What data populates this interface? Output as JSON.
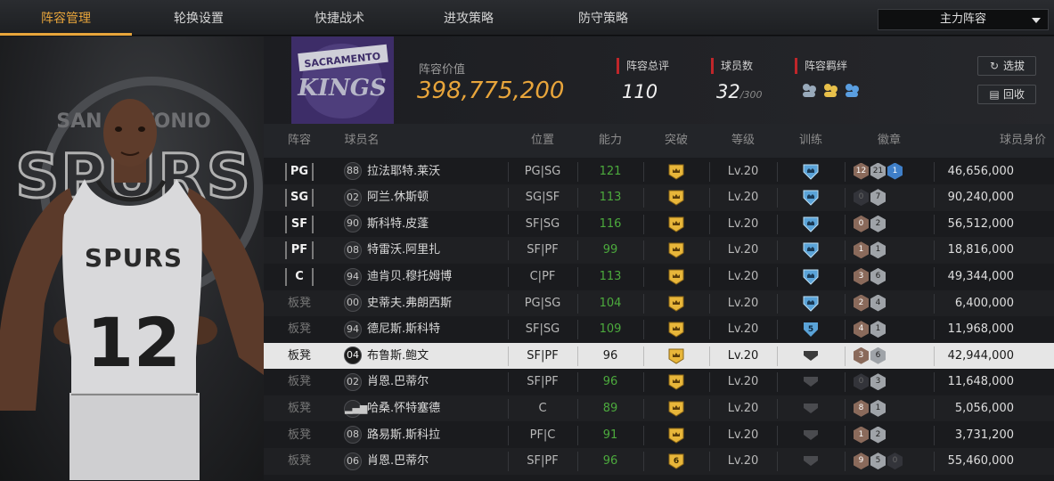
{
  "tabs": [
    {
      "label": "阵容管理",
      "active": true
    },
    {
      "label": "轮换设置",
      "active": false
    },
    {
      "label": "快捷战术",
      "active": false
    },
    {
      "label": "进攻策略",
      "active": false
    },
    {
      "label": "防守策略",
      "active": false
    }
  ],
  "lineup_select": {
    "value": "主力阵容"
  },
  "header": {
    "team_logo_text_top": "SACRAMENTO",
    "team_logo_text_main": "KINGS",
    "value_label": "阵容价值",
    "value": "398,775,200",
    "rating_label": "阵容总评",
    "rating": "110",
    "players_label": "球员数",
    "players_count": "32",
    "players_max": "/300",
    "bond_label": "阵容羁绊",
    "select_button": "选拔",
    "recycle_button": "回收"
  },
  "jersey": {
    "team": "SPURS",
    "number": "12",
    "bg_team": "SPURS",
    "bg_text": "SAN ANTONIO"
  },
  "columns": [
    "阵容",
    "球员名",
    "位置",
    "能力",
    "突破",
    "等级",
    "训练",
    "徽章",
    "球员身价"
  ],
  "rows": [
    {
      "slot": "PG",
      "starter": true,
      "number": "88",
      "name": "拉法耶特.莱沃",
      "pos": "PG|SG",
      "ability": "121",
      "level": "Lv.20",
      "train": "",
      "badges": [
        {
          "t": "12",
          "c": "bronze"
        },
        {
          "t": "21",
          "c": "silver"
        },
        {
          "t": "1",
          "c": "blue"
        }
      ],
      "salary": "46,656,000"
    },
    {
      "slot": "SG",
      "starter": true,
      "number": "02",
      "name": "阿兰.休斯顿",
      "pos": "SG|SF",
      "ability": "113",
      "level": "Lv.20",
      "train": "",
      "badges": [
        {
          "t": "0",
          "c": "dark"
        },
        {
          "t": "7",
          "c": "silver"
        }
      ],
      "salary": "90,240,000"
    },
    {
      "slot": "SF",
      "starter": true,
      "number": "90",
      "name": "斯科特.皮蓬",
      "pos": "SF|SG",
      "ability": "116",
      "level": "Lv.20",
      "train": "",
      "badges": [
        {
          "t": "0",
          "c": "bronze"
        },
        {
          "t": "2",
          "c": "silver"
        }
      ],
      "salary": "56,512,000"
    },
    {
      "slot": "PF",
      "starter": true,
      "number": "08",
      "name": "特雷沃.阿里扎",
      "pos": "SF|PF",
      "ability": "99",
      "level": "Lv.20",
      "train": "",
      "badges": [
        {
          "t": "1",
          "c": "bronze"
        },
        {
          "t": "1",
          "c": "silver"
        }
      ],
      "salary": "18,816,000"
    },
    {
      "slot": "C",
      "starter": true,
      "number": "94",
      "name": "迪肯贝.穆托姆博",
      "pos": "C|PF",
      "ability": "113",
      "level": "Lv.20",
      "train": "",
      "badges": [
        {
          "t": "3",
          "c": "bronze"
        },
        {
          "t": "6",
          "c": "silver"
        }
      ],
      "salary": "49,344,000"
    },
    {
      "slot": "板凳",
      "starter": false,
      "number": "00",
      "name": "史蒂夫.弗朗西斯",
      "pos": "PG|SG",
      "ability": "104",
      "level": "Lv.20",
      "train": "",
      "badges": [
        {
          "t": "2",
          "c": "bronze"
        },
        {
          "t": "4",
          "c": "silver"
        }
      ],
      "salary": "6,400,000"
    },
    {
      "slot": "板凳",
      "starter": false,
      "number": "94",
      "name": "德尼斯.斯科特",
      "pos": "SF|SG",
      "ability": "109",
      "level": "Lv.20",
      "train": "5",
      "badges": [
        {
          "t": "4",
          "c": "bronze"
        },
        {
          "t": "1",
          "c": "silver"
        }
      ],
      "salary": "11,968,000"
    },
    {
      "slot": "板凳",
      "starter": false,
      "number": "04",
      "name": "布鲁斯.鲍文",
      "pos": "SF|PF",
      "ability": "96",
      "level": "Lv.20",
      "train": "",
      "badges": [
        {
          "t": "3",
          "c": "bronze"
        },
        {
          "t": "6",
          "c": "silver"
        }
      ],
      "salary": "42,944,000",
      "selected": true
    },
    {
      "slot": "板凳",
      "starter": false,
      "number": "02",
      "name": "肖恩.巴蒂尔",
      "pos": "SF|PF",
      "ability": "96",
      "level": "Lv.20",
      "train": "",
      "badges": [
        {
          "t": "0",
          "c": "dark"
        },
        {
          "t": "3",
          "c": "silver"
        }
      ],
      "salary": "11,648,000"
    },
    {
      "slot": "板凳",
      "starter": false,
      "number": "",
      "name": "哈桑.怀特塞德",
      "pos": "C",
      "ability": "89",
      "level": "Lv.20",
      "train": "",
      "badges": [
        {
          "t": "8",
          "c": "bronze"
        },
        {
          "t": "1",
          "c": "silver"
        }
      ],
      "salary": "5,056,000"
    },
    {
      "slot": "板凳",
      "starter": false,
      "number": "08",
      "name": "路易斯.斯科拉",
      "pos": "PF|C",
      "ability": "91",
      "level": "Lv.20",
      "train": "",
      "badges": [
        {
          "t": "1",
          "c": "bronze"
        },
        {
          "t": "2",
          "c": "silver"
        }
      ],
      "salary": "3,731,200"
    },
    {
      "slot": "板凳",
      "starter": false,
      "number": "06",
      "name": "肖恩.巴蒂尔",
      "pos": "SF|PF",
      "ability": "96",
      "level": "Lv.20",
      "break": "6",
      "train": "",
      "badges": [
        {
          "t": "9",
          "c": "bronze"
        },
        {
          "t": "5",
          "c": "silver"
        },
        {
          "t": "0",
          "c": "dark"
        }
      ],
      "salary": "55,460,000"
    }
  ],
  "colors": {
    "accent": "#e8a53b",
    "ability_green": "#4caa3d",
    "stat_red": "#c0262a",
    "kings_purple": "#3d2d68"
  }
}
